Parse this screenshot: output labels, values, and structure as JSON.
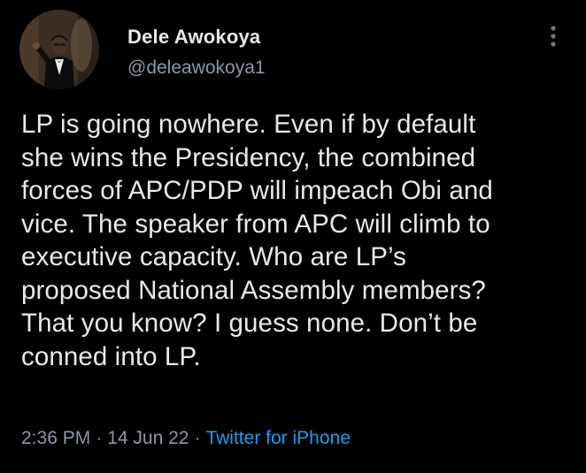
{
  "tweet": {
    "author": {
      "display_name": "Dele Awokoya",
      "handle": "@deleawokoya1"
    },
    "text": "LP is going nowhere. Even if by default\nshe wins the Presidency, the combined\nforces of APC/PDP will impeach Obi and\nvice. The speaker from APC will climb to\nexecutive capacity. Who are LP’s\nproposed National Assembly members?\nThat you know? I guess none. Don’t be\nconned into LP.",
    "time": "2:36 PM",
    "date": "14 Jun 22",
    "separator": "·",
    "source": "Twitter for iPhone"
  },
  "icons": {
    "more": "more-vertical-icon"
  },
  "colors": {
    "background": "#000000",
    "primary_text": "#e7e9ea",
    "secondary_text": "#8b98a5",
    "accent": "#1d9bf0"
  }
}
